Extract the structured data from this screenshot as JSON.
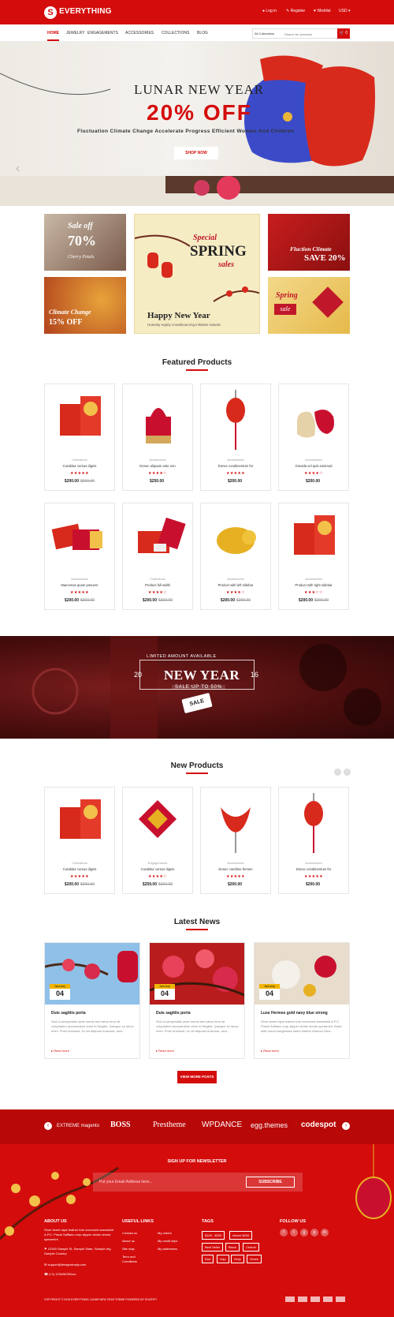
{
  "header": {
    "logo_text": "EVERYTHING",
    "logo_badge": "S",
    "links": [
      "Log in",
      "Register",
      "Wishlist",
      "USD"
    ]
  },
  "nav": {
    "items": [
      "HOME",
      "JEWELRY",
      "ENGAGEMENTS",
      "ACCESSORIES",
      "COLLECTIONS",
      "BLOG"
    ],
    "category_select": "All Collections",
    "search_placeholder": "Search for products",
    "cart_count": "0"
  },
  "hero": {
    "title": "LUNAR NEW YEAR",
    "sale": "20% OFF",
    "subtitle": "Fluctuation Climate Change Accelerate Progress Efficient Women And Children",
    "button": "SHOP NOW"
  },
  "promos": {
    "p1_line1": "Sale off",
    "p1_line2": "70%",
    "p1_line3": "Cherry Petals",
    "p2_line1": "Climate Change",
    "p2_line2": "15% OFF",
    "p3_line1": "Special",
    "p3_line2": "SPRING",
    "p3_line3": "sales",
    "p3_line4": "Happy New Year",
    "p3_line5": "Honesty equity crowdsourcing initiative natural",
    "p4_line1": "Fluction Climate",
    "p4_line2": "SAVE 20%",
    "p5_line1": "Spring",
    "p5_line2": "sale"
  },
  "featured": {
    "title": "Featured Products",
    "products": [
      {
        "cat": "Collections",
        "name": "Curabitur cursus dignis",
        "stars": "★★★★★",
        "price": "$200.00",
        "old": "$300.00"
      },
      {
        "cat": "Accessories",
        "name": "Donec aliquam ante non",
        "stars": "★★★★☆",
        "price": "$250.00",
        "old": ""
      },
      {
        "cat": "Accessories",
        "name": "Donec condimentum for",
        "stars": "★★★★★",
        "price": "$200.00",
        "old": ""
      },
      {
        "cat": "Accessories",
        "name": "Gravida vel quis euismod",
        "stars": "★★★★☆",
        "price": "$200.00",
        "old": ""
      },
      {
        "cat": "Accessories",
        "name": "Maecenas quam posuere",
        "stars": "★★★★★",
        "price": "$200.00",
        "old": "$300.00"
      },
      {
        "cat": "Collections",
        "name": "Product full width",
        "stars": "★★★★☆",
        "price": "$200.00",
        "old": "$300.00"
      },
      {
        "cat": "Accessories",
        "name": "Product with left sidebar",
        "stars": "★★★★☆",
        "price": "$200.00",
        "old": "$300.00"
      },
      {
        "cat": "Accessories",
        "name": "Product with right sidebar",
        "stars": "★★★☆☆",
        "price": "$200.00",
        "old": "$300.00"
      }
    ]
  },
  "midbanner": {
    "limited": "LIMITED AMOUNT AVAILABLE",
    "year_left": "20",
    "year_right": "16",
    "title": "NEW YEAR",
    "subtitle": "SALE UP TO 50%",
    "tag": "SALE"
  },
  "new_products": {
    "title": "New Products",
    "products": [
      {
        "cat": "Collections",
        "name": "Curabitur cursus dignis",
        "stars": "★★★★★",
        "price": "$200.00",
        "old": "$300.00"
      },
      {
        "cat": "Engagements",
        "name": "Curabitur cursus dignis",
        "stars": "★★★★☆",
        "price": "$259.00",
        "old": "$300.00"
      },
      {
        "cat": "Accessories",
        "name": "Donec condime fermen",
        "stars": "★★★★★",
        "price": "$200.00",
        "old": ""
      },
      {
        "cat": "Accessories",
        "name": "Donec condimentum for",
        "stars": "★★★★★",
        "price": "$200.00",
        "old": ""
      }
    ]
  },
  "news": {
    "title": "Latest News",
    "posts": [
      {
        "month": "January",
        "day": "04",
        "title": "Duis sagittis porta",
        "excerpt": "Sed ut perspiciatis unde omnis iste natus error sit voluptatem accusantium dolor et fringilla. Quisque eu lacus enim. Proin tincidunt, ex vel aliquam euismod, arcu...",
        "more": "Read more"
      },
      {
        "month": "January",
        "day": "04",
        "title": "Duis sagittis porta",
        "excerpt": "Sed ut perspiciatis unde omnis iste natus error sit voluptatem accusantium dolor et fringilla. Quisque eu lacus enim. Proin tincidunt, ex vel aliquam euismod, arcu...",
        "more": "Read more"
      },
      {
        "month": "January",
        "day": "04",
        "title": "Luxe Hermes gold navy blue strong",
        "excerpt": "Shoe street style leather tote oversized sweatshirt A.P.C. Prada Saffiano crop slipper denim shorts spearmint. Braid skirt round sunglasses seam leather missoni Zara...",
        "more": "Read more"
      }
    ],
    "view_more": "VIEW MORE POSTS"
  },
  "brands": [
    "EXTREME magento",
    "BOSS",
    "Prestheme",
    "WPDANCE",
    "egg.themes",
    "codespot"
  ],
  "footer": {
    "newsletter_title": "SIGN UP FOR NEWSLETTER",
    "newsletter_placeholder": "Put your Email Address here...",
    "subscribe": "SUBSCRIBE",
    "about_title": "ABOUT US",
    "about_text": "Shoe street style leather tote oversized sweatshirt A.P.C. Prada Saffiano crop slipper denim shorts spearmint.",
    "address": "12345 Sample St, Sample State, Sample city, Sample Country",
    "email": "support@designsimply.com",
    "phone": "(+1) 123456789xxx",
    "links_title": "USEFUL LINKS",
    "links_col1": [
      "Contact us",
      "About us",
      "Site map",
      "Term and Conditions"
    ],
    "links_col2": [
      "My orders",
      "My credit slips",
      "My addresses"
    ],
    "tags_title": "TAGS",
    "tags": [
      "$100 - $200",
      "Above $200",
      "Best Seller",
      "Black",
      "Chanel",
      "Dior",
      "Gap",
      "Grey",
      "Green"
    ],
    "follow_title": "FOLLOW US",
    "social": [
      "f",
      "t",
      "g",
      "p",
      "in"
    ],
    "copyright": "COPYRIGHT © 2016 EVERYTHING LUNAR NEW YEAR THEME POWERED BY SHOPIFY"
  }
}
